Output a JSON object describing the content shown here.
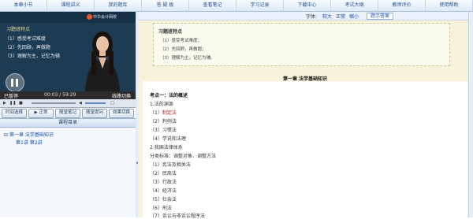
{
  "nav": {
    "items": [
      "本章小节",
      "课程讲义",
      "我的题库",
      "答 疑 板",
      "查看笔记",
      "学习记录",
      "下载中心",
      "考试大纲",
      "教师评价",
      "使用帮助"
    ]
  },
  "video": {
    "logo": "中华会计网校",
    "slide_title": "习题班特点",
    "slide_lines": [
      "（1）感受考试难度",
      "（2）先回顾，再做题",
      "（3）理解为主，记忆为辅"
    ],
    "status": "已暂停",
    "time": "00:03 / 59:29",
    "switch_label": "线路切换"
  },
  "controls": {
    "buttons": [
      "时间选择",
      "正常",
      "随堂笔记",
      "随堂提问",
      "效果切换"
    ],
    "normal_prefix": "▶"
  },
  "catalog": {
    "title": "课程目录",
    "chapter": "第一章   法学基础知识",
    "lesson": "第1讲 第2讲"
  },
  "font": {
    "label": "字体:",
    "options": [
      "较大",
      "正常",
      "缩小"
    ],
    "answer_tab": "题示答案"
  },
  "tips": {
    "title": "习题班特点",
    "lines": [
      "（1）感受考试难度；",
      "（2）先回顾，再做题；",
      "（3）理解为主，记忆为辅。"
    ]
  },
  "content": {
    "chapter_heading": "第一章   法学基础知识",
    "lines": [
      {
        "text": "考点一：法的概述",
        "bold": true
      },
      {
        "text": "1.法的渊源",
        "bold": false
      },
      {
        "pre": "（1）",
        "red": "制定法",
        "bold": false
      },
      {
        "text": "（2）判例法",
        "bold": false
      },
      {
        "text": "（3）习惯法",
        "bold": false
      },
      {
        "text": "（4）学说和法理",
        "bold": false
      },
      {
        "text": "2.我国法律体系",
        "bold": false
      },
      {
        "text": "分类标准：调整对象、调整方法",
        "bold": false
      },
      {
        "text": "（1）宪法及相关法",
        "bold": false
      },
      {
        "text": "（2）民商法",
        "bold": false
      },
      {
        "text": "（3）行政法",
        "bold": false
      },
      {
        "text": "（4）经济法",
        "bold": false
      },
      {
        "text": "（5）社会法",
        "bold": false
      },
      {
        "text": "（6）刑法",
        "bold": false
      },
      {
        "text": "（7）诉讼与非诉讼程序法",
        "bold": false
      }
    ]
  },
  "colors": {
    "nav_text": "#2a4f86",
    "link": "#1b4fa0",
    "highlight": "#c21d1d",
    "content_bg": "#f7f3da"
  }
}
